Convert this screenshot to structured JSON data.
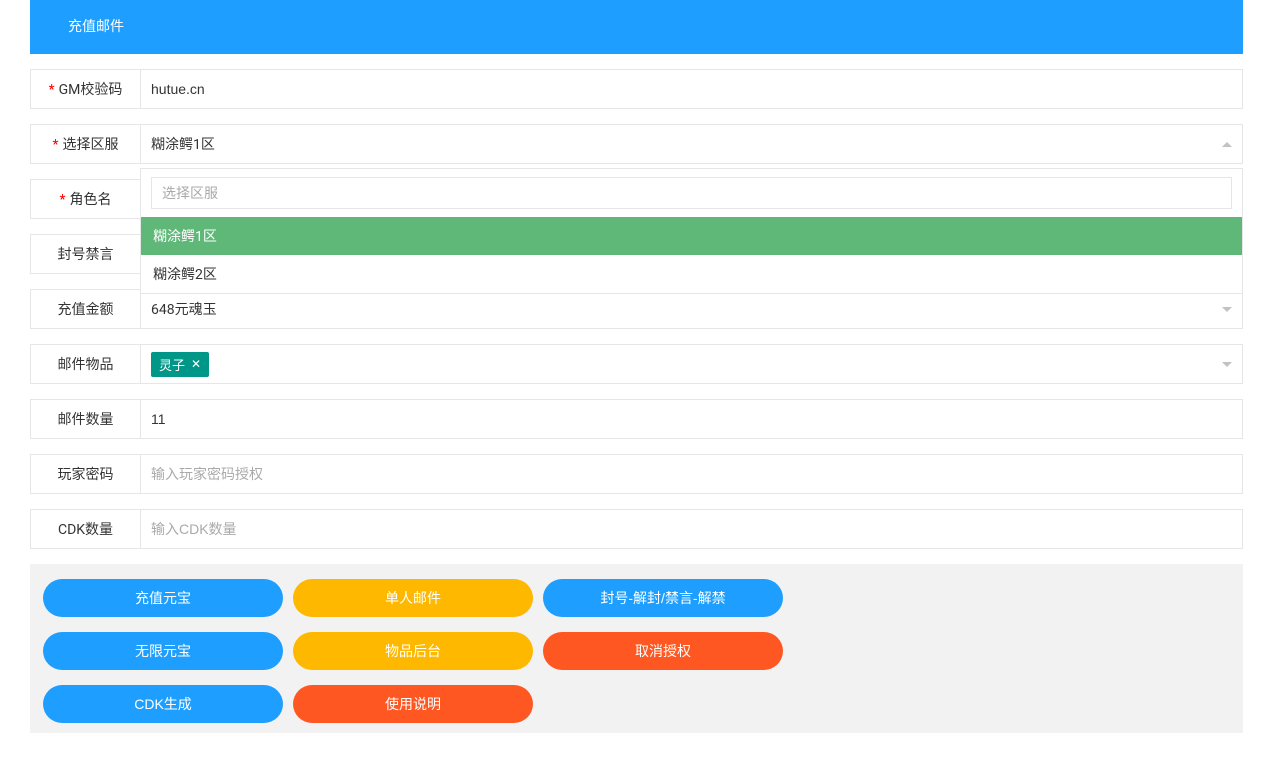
{
  "header": {
    "title": "充值邮件"
  },
  "fields": {
    "gm_code": {
      "label": "GM校验码",
      "value": "hutue.cn"
    },
    "server": {
      "label": "选择区服",
      "value": "糊涂鳄1区",
      "search_placeholder": "选择区服",
      "options": [
        "糊涂鳄1区",
        "糊涂鳄2区"
      ]
    },
    "role": {
      "label": "角色名"
    },
    "ban": {
      "label": "封号禁言"
    },
    "recharge": {
      "label": "充值金额",
      "value": "648元魂玉"
    },
    "mail_item": {
      "label": "邮件物品",
      "tag": "灵子"
    },
    "mail_qty": {
      "label": "邮件数量",
      "value": "11"
    },
    "player_pwd": {
      "label": "玩家密码",
      "placeholder": "输入玩家密码授权"
    },
    "cdk_qty": {
      "label": "CDK数量",
      "placeholder": "输入CDK数量"
    }
  },
  "buttons": {
    "row1": [
      "充值元宝",
      "单人邮件",
      "封号-解封/禁言-解禁"
    ],
    "row2": [
      "无限元宝",
      "物品后台",
      "取消授权"
    ],
    "row3": [
      "CDK生成",
      "使用说明"
    ]
  }
}
